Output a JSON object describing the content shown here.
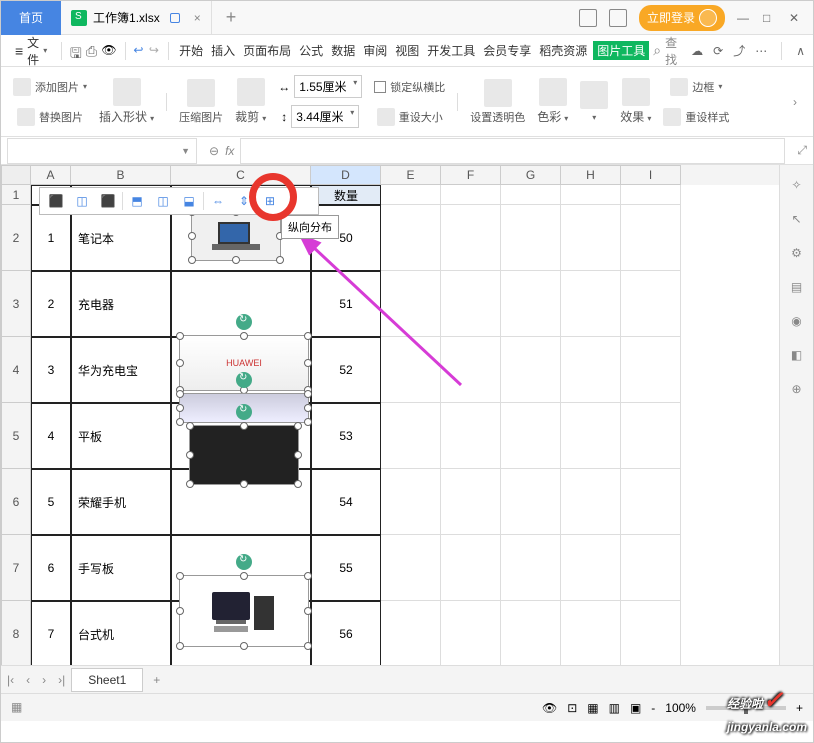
{
  "titlebar": {
    "home": "首页",
    "filename": "工作簿1.xlsx",
    "new_tab": "+",
    "login": "立即登录"
  },
  "menubar": {
    "file": "文件",
    "tabs": [
      "开始",
      "插入",
      "页面布局",
      "公式",
      "数据",
      "审阅",
      "视图",
      "开发工具",
      "会员专享",
      "稻壳资源",
      "图片工具"
    ],
    "active": "图片工具",
    "search": "查找"
  },
  "ribbon": {
    "add_image": "添加图片",
    "replace_image": "替换图片",
    "insert_shape": "插入形状",
    "compress": "压缩图片",
    "crop": "裁剪",
    "width": "1.55厘米",
    "height": "3.44厘米",
    "lock_ratio": "锁定纵横比",
    "reset_size": "重设大小",
    "transparency": "设置透明色",
    "color": "色彩",
    "effects": "效果",
    "border": "边框",
    "reset_style": "重设样式"
  },
  "columns": [
    "A",
    "B",
    "C",
    "D",
    "E",
    "F",
    "G",
    "H",
    "I"
  ],
  "headers": {
    "d": "数量"
  },
  "data_rows": [
    {
      "n": "1",
      "name": "笔记本",
      "qty": "50"
    },
    {
      "n": "2",
      "name": "充电器",
      "qty": "51"
    },
    {
      "n": "3",
      "name": "华为充电宝",
      "qty": "52"
    },
    {
      "n": "4",
      "name": "平板",
      "qty": "53"
    },
    {
      "n": "5",
      "name": "荣耀手机",
      "qty": "54"
    },
    {
      "n": "6",
      "name": "手写板",
      "qty": "55"
    },
    {
      "n": "7",
      "name": "台式机",
      "qty": "56"
    }
  ],
  "tooltip": "纵向分布",
  "sheet_tab": "Sheet1",
  "status": {
    "zoom": "100%",
    "minus": "-",
    "plus": "+"
  },
  "watermark": {
    "text": "经验啦",
    "url": "jingyanla.com"
  }
}
